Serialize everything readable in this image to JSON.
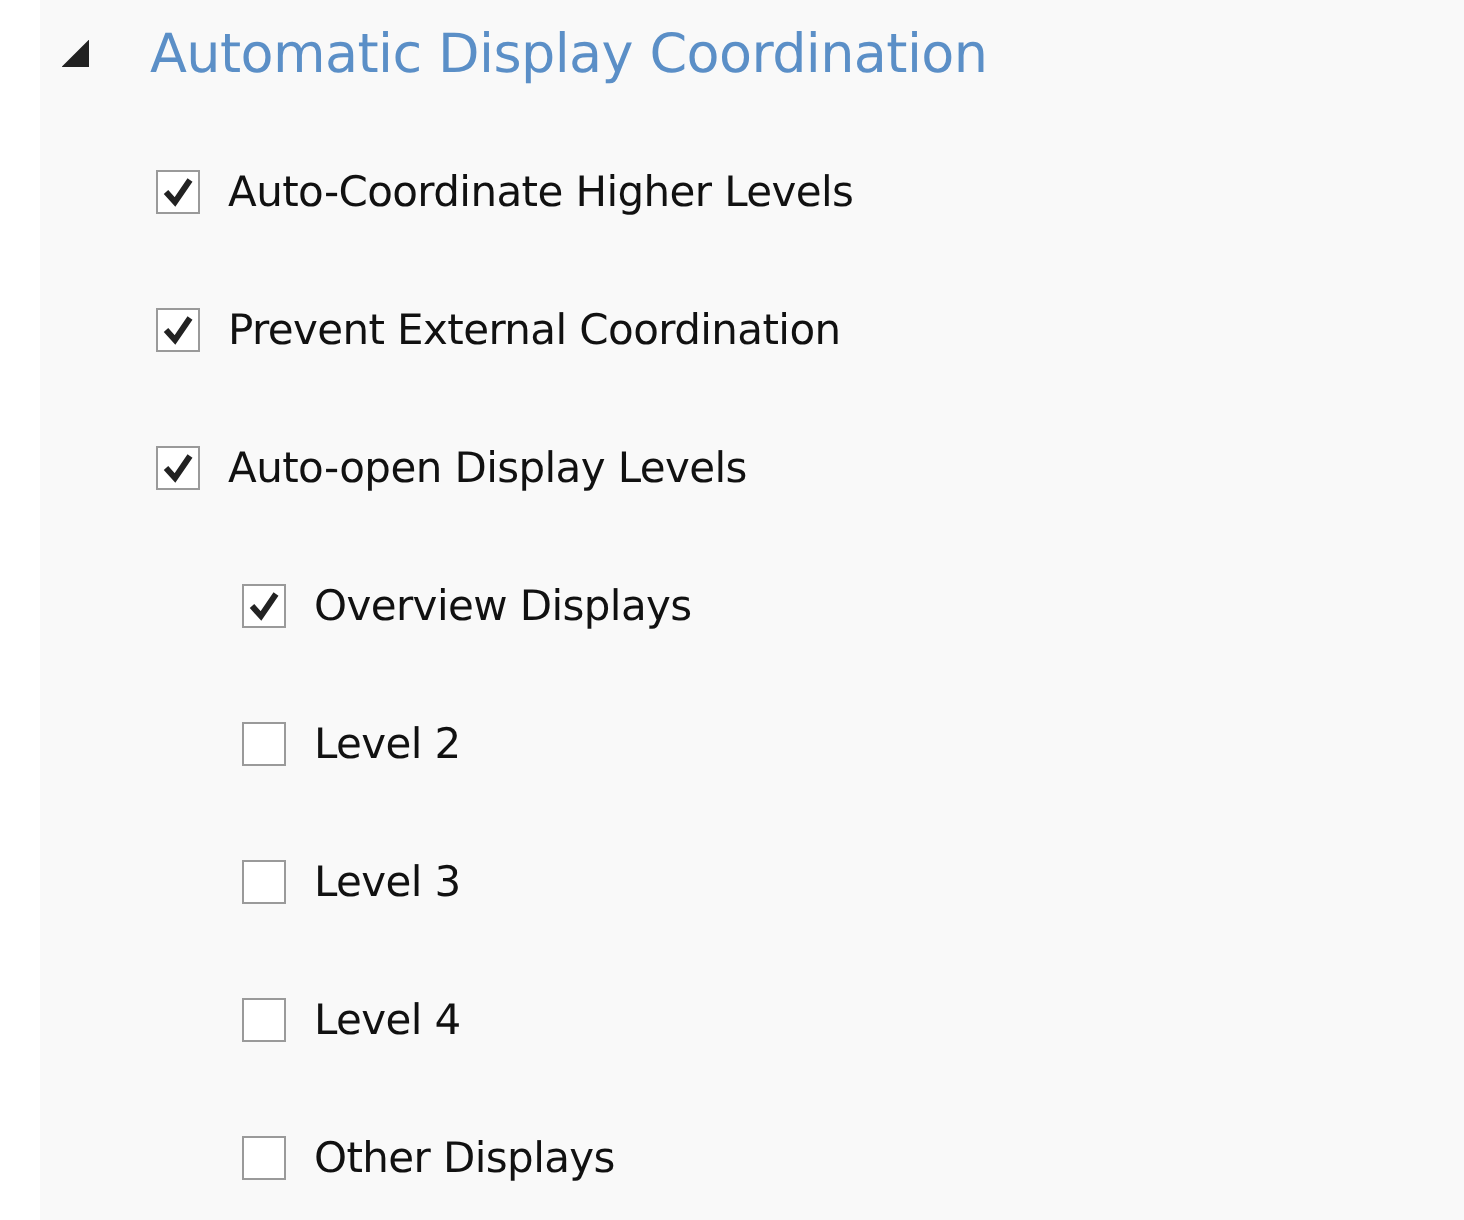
{
  "section": {
    "title": "Automatic Display Coordination",
    "expanded": true,
    "options": [
      {
        "label": "Auto-Coordinate Higher Levels",
        "checked": true
      },
      {
        "label": "Prevent External Coordination",
        "checked": true
      },
      {
        "label": "Auto-open Display Levels",
        "checked": true,
        "children": [
          {
            "label": "Overview Displays",
            "checked": true
          },
          {
            "label": "Level 2",
            "checked": false
          },
          {
            "label": "Level 3",
            "checked": false
          },
          {
            "label": "Level 4",
            "checked": false
          },
          {
            "label": "Other Displays",
            "checked": false
          }
        ]
      }
    ]
  }
}
